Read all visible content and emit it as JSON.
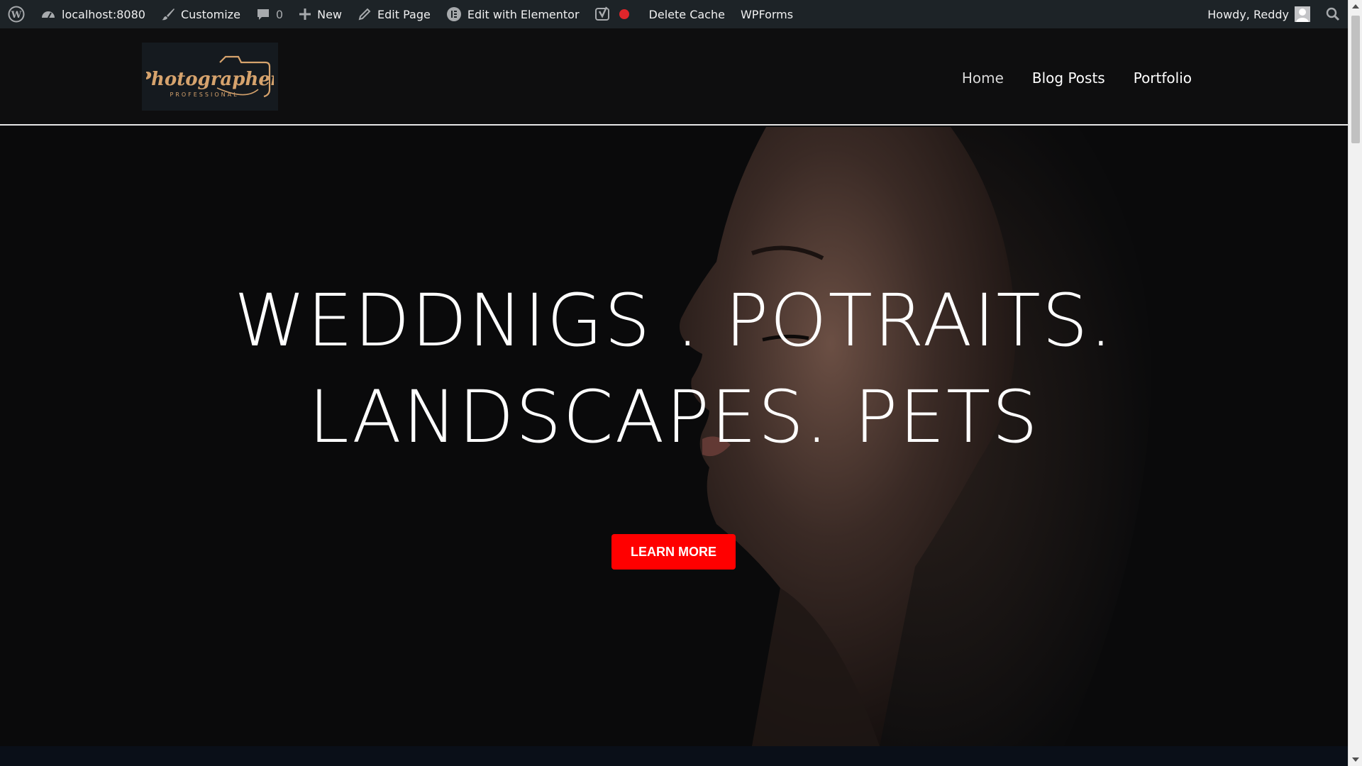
{
  "admin_bar": {
    "site": "localhost:8080",
    "customize": "Customize",
    "comments_count": "0",
    "new": "New",
    "edit_page": "Edit Page",
    "edit_elementor": "Edit with Elementor",
    "delete_cache": "Delete Cache",
    "wpforms": "WPForms",
    "howdy": "Howdy, Reddy"
  },
  "header": {
    "logo": {
      "text": "Photographer",
      "subtext": "PROFESSIONAL"
    },
    "nav": [
      "Home",
      "Blog Posts",
      "Portfolio"
    ]
  },
  "hero": {
    "line1": "WEDDNIGS . POTRAITS.",
    "line2": "LANDSCAPES. PETS",
    "button": "LEARN MORE"
  },
  "colors": {
    "admin_bar_bg": "#1d2327",
    "page_bg": "#0d0d0e",
    "cta": "#ff0000",
    "logo_gold": "#d6a36d"
  },
  "icons": [
    "wordpress-icon",
    "dashboard-icon",
    "brush-icon",
    "comment-icon",
    "plus-icon",
    "pencil-icon",
    "elementor-icon",
    "yoast-icon",
    "status-dot-icon",
    "avatar",
    "search-icon"
  ]
}
